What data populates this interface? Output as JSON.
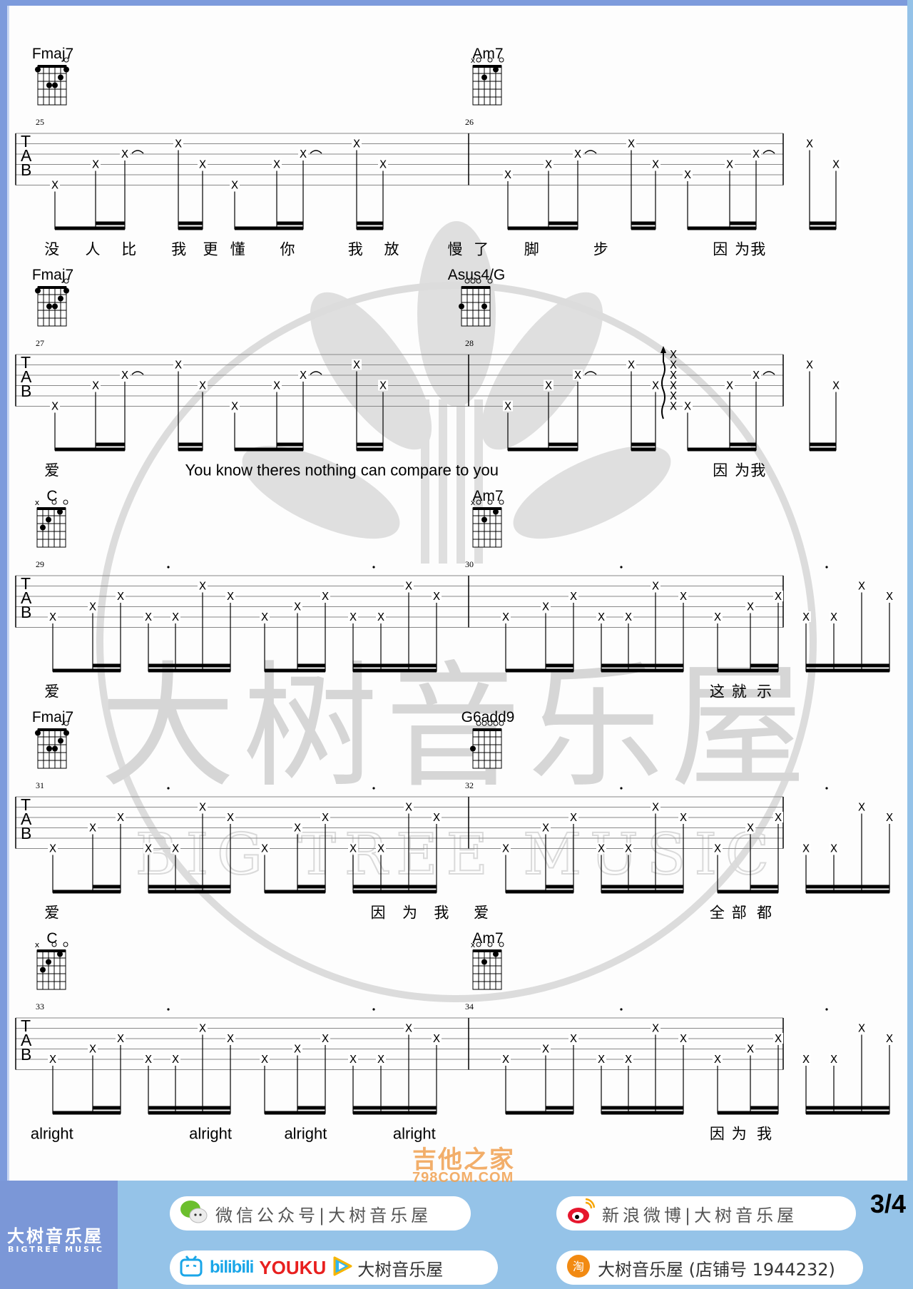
{
  "colors": {
    "frame": "#7d9bdc",
    "footer_bg": "#95c3e8",
    "brand_bg": "#7b97d7",
    "watermark": "#d9d9d9"
  },
  "watermark": {
    "title": "大树音乐屋",
    "subtitle": "BIG TREE MUSIC"
  },
  "chords": {
    "Fmaj7": {
      "name": "Fmaj7",
      "top": [
        "",
        "",
        "",
        "",
        "",
        "o"
      ],
      "dots": [
        [
          6,
          1
        ],
        [
          4,
          3
        ],
        [
          3,
          3
        ],
        [
          2,
          2
        ],
        [
          1,
          1
        ]
      ]
    },
    "G6add9": {
      "name": "G6add9",
      "top": [
        "",
        "o",
        "o",
        "o",
        "o",
        "o"
      ],
      "dots": [
        [
          6,
          3
        ]
      ]
    },
    "Am7": {
      "name": "Am7",
      "top": [
        "x",
        "o",
        "",
        "o",
        "",
        "o"
      ],
      "dots": [
        [
          4,
          2
        ],
        [
          2,
          1
        ]
      ]
    },
    "Asus4/G": {
      "name": "Asus4/G",
      "top": [
        "",
        "o",
        "o",
        "o",
        "",
        "o"
      ],
      "dots": [
        [
          6,
          3
        ],
        [
          2,
          3
        ]
      ]
    },
    "C": {
      "name": "C",
      "top": [
        "x",
        "",
        "",
        "o",
        "",
        "o"
      ],
      "dots": [
        [
          5,
          3
        ],
        [
          4,
          2
        ],
        [
          2,
          1
        ]
      ]
    }
  },
  "systems": [
    {
      "measures": [
        {
          "number": "25",
          "chord": "Fmaj7",
          "pattern": "A",
          "notes": [
            [
              6
            ],
            [
              4
            ],
            [
              3,
              "tie"
            ],
            [
              2
            ],
            [
              4
            ],
            [
              6
            ],
            [
              4
            ],
            [
              3,
              "tie"
            ],
            [
              2
            ],
            [
              4
            ]
          ]
        },
        {
          "number": "26",
          "chord": "Am7",
          "pattern": "A",
          "notes": [
            [
              5
            ],
            [
              4
            ],
            [
              3,
              "tie"
            ],
            [
              2
            ],
            [
              4
            ],
            [
              5
            ],
            [
              4
            ],
            [
              3,
              "tie"
            ],
            [
              2
            ],
            [
              4
            ]
          ]
        }
      ],
      "lyrics": [
        {
          "text": "没",
          "beat": 0.08,
          "m": 0
        },
        {
          "text": "人",
          "beat": 0.17,
          "m": 0
        },
        {
          "text": "比",
          "beat": 0.25,
          "m": 0
        },
        {
          "text": "我",
          "beat": 0.36,
          "m": 0
        },
        {
          "text": "更",
          "beat": 0.43,
          "m": 0
        },
        {
          "text": "懂",
          "beat": 0.49,
          "m": 0
        },
        {
          "text": "你",
          "beat": 0.6,
          "m": 0
        },
        {
          "text": "我",
          "beat": 0.75,
          "m": 0
        },
        {
          "text": "放",
          "beat": 0.83,
          "m": 0
        },
        {
          "text": "慢",
          "beat": 0.97,
          "m": 0
        },
        {
          "text": "了",
          "beat": 0.04,
          "m": 1
        },
        {
          "text": "脚",
          "beat": 0.2,
          "m": 1
        },
        {
          "text": "步",
          "beat": 0.42,
          "m": 1
        },
        {
          "text": "因",
          "beat": 0.8,
          "m": 1
        },
        {
          "text": "为",
          "beat": 0.87,
          "m": 1
        },
        {
          "text": "我",
          "beat": 0.92,
          "m": 1
        }
      ]
    },
    {
      "measures": [
        {
          "number": "27",
          "chord": "Fmaj7",
          "pattern": "A",
          "notes": [
            [
              6
            ],
            [
              4
            ],
            [
              3,
              "tie"
            ],
            [
              2
            ],
            [
              4
            ],
            [
              6
            ],
            [
              4
            ],
            [
              3,
              "tie"
            ],
            [
              2
            ],
            [
              4
            ]
          ]
        },
        {
          "number": "28",
          "chord": "Asus4/G",
          "pattern": "A",
          "strum_at": 5,
          "notes": [
            [
              6
            ],
            [
              4
            ],
            [
              3,
              "tie"
            ],
            [
              2
            ],
            [
              4
            ],
            [
              6
            ],
            [
              4
            ],
            [
              3,
              "tie"
            ],
            [
              2
            ],
            [
              4
            ]
          ]
        }
      ],
      "lyrics": [
        {
          "text": "爱",
          "beat": 0.08,
          "m": 0
        },
        {
          "text": "You know theres nothing can compare to  you",
          "beat": 0.72,
          "m": 0,
          "en": true
        },
        {
          "text": "因",
          "beat": 0.8,
          "m": 1
        },
        {
          "text": "为",
          "beat": 0.87,
          "m": 1
        },
        {
          "text": "我",
          "beat": 0.92,
          "m": 1
        }
      ]
    },
    {
      "dots": true,
      "measures": [
        {
          "number": "29",
          "chord": "C",
          "pattern": "B",
          "notes": [
            [
              5
            ],
            [
              4
            ],
            [
              3
            ],
            [
              5
            ],
            [
              5
            ],
            [
              2
            ],
            [
              3
            ],
            [
              5
            ],
            [
              4
            ],
            [
              3
            ],
            [
              5
            ],
            [
              5
            ],
            [
              2
            ],
            [
              3
            ]
          ]
        },
        {
          "number": "30",
          "chord": "Am7",
          "pattern": "B",
          "notes": [
            [
              5
            ],
            [
              4
            ],
            [
              3
            ],
            [
              5
            ],
            [
              5
            ],
            [
              2
            ],
            [
              3
            ],
            [
              5
            ],
            [
              4
            ],
            [
              3
            ],
            [
              5
            ],
            [
              5
            ],
            [
              2
            ],
            [
              3
            ]
          ]
        }
      ],
      "lyrics": [
        {
          "text": "爱",
          "beat": 0.08,
          "m": 0
        },
        {
          "text": "这",
          "beat": 0.79,
          "m": 1
        },
        {
          "text": "就",
          "beat": 0.86,
          "m": 1
        },
        {
          "text": "示",
          "beat": 0.94,
          "m": 1
        }
      ]
    },
    {
      "dots": true,
      "measures": [
        {
          "number": "31",
          "chord": "Fmaj7",
          "pattern": "B",
          "notes": [
            [
              6
            ],
            [
              4
            ],
            [
              3
            ],
            [
              6
            ],
            [
              6
            ],
            [
              2
            ],
            [
              3
            ],
            [
              6
            ],
            [
              4
            ],
            [
              3
            ],
            [
              6
            ],
            [
              6
            ],
            [
              2
            ],
            [
              3
            ]
          ]
        },
        {
          "number": "32",
          "chord": "G6add9",
          "pattern": "B",
          "notes": [
            [
              6
            ],
            [
              4
            ],
            [
              3
            ],
            [
              6
            ],
            [
              6
            ],
            [
              2
            ],
            [
              3
            ],
            [
              6
            ],
            [
              4
            ],
            [
              3
            ],
            [
              6
            ],
            [
              6
            ],
            [
              2
            ],
            [
              3
            ]
          ]
        }
      ],
      "lyrics": [
        {
          "text": "爱",
          "beat": 0.08,
          "m": 0
        },
        {
          "text": "因",
          "beat": 0.8,
          "m": 0
        },
        {
          "text": "为",
          "beat": 0.87,
          "m": 0
        },
        {
          "text": "我",
          "beat": 0.94,
          "m": 0
        },
        {
          "text": "爱",
          "beat": 0.04,
          "m": 1
        },
        {
          "text": "全",
          "beat": 0.79,
          "m": 1
        },
        {
          "text": "部",
          "beat": 0.86,
          "m": 1
        },
        {
          "text": "都",
          "beat": 0.94,
          "m": 1
        }
      ]
    },
    {
      "dots": true,
      "measures": [
        {
          "number": "33",
          "chord": "C",
          "pattern": "B",
          "notes": [
            [
              5
            ],
            [
              4
            ],
            [
              3
            ],
            [
              5
            ],
            [
              5
            ],
            [
              2
            ],
            [
              3
            ],
            [
              5
            ],
            [
              4
            ],
            [
              3
            ],
            [
              5
            ],
            [
              5
            ],
            [
              2
            ],
            [
              3
            ]
          ]
        },
        {
          "number": "34",
          "chord": "Am7",
          "pattern": "B",
          "notes": [
            [
              5
            ],
            [
              4
            ],
            [
              3
            ],
            [
              5
            ],
            [
              5
            ],
            [
              2
            ],
            [
              3
            ],
            [
              5
            ],
            [
              4
            ],
            [
              3
            ],
            [
              5
            ],
            [
              5
            ],
            [
              2
            ],
            [
              3
            ]
          ]
        }
      ],
      "lyrics": [
        {
          "text": "alright",
          "beat": 0.08,
          "m": 0,
          "en": true
        },
        {
          "text": "alright",
          "beat": 0.43,
          "m": 0,
          "en": true
        },
        {
          "text": "alright",
          "beat": 0.64,
          "m": 0,
          "en": true
        },
        {
          "text": "alright",
          "beat": 0.88,
          "m": 0,
          "en": true
        },
        {
          "text": "因",
          "beat": 0.79,
          "m": 1
        },
        {
          "text": "为",
          "beat": 0.86,
          "m": 1
        },
        {
          "text": "我",
          "beat": 0.94,
          "m": 1
        }
      ]
    }
  ],
  "tab_letters": [
    "T",
    "A",
    "B"
  ],
  "x_glyph": "X",
  "footer": {
    "brand_cn": "大树音乐屋",
    "brand_en": "BIGTREE MUSIC",
    "wechat": "微信公众号|大树音乐屋",
    "weibo": "新浪微博|大树音乐屋",
    "video_bili": "bilibili",
    "video_youku": "YOUKU",
    "video_name": "大树音乐屋",
    "taobao": "大树音乐屋 (店铺号 1944232)",
    "page": "3/4",
    "overlay": "吉他之家",
    "overlay_url": "798COM.COM"
  }
}
